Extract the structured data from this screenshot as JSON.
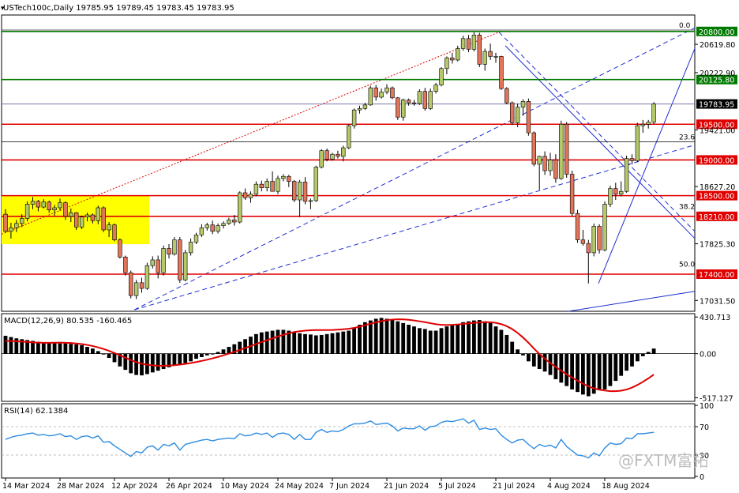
{
  "header": {
    "symbol_info": "USTech100c,Daily  19785.95 19789.45 19783.45 19783.95"
  },
  "colors": {
    "bull": "#b5c96a",
    "bear": "#e2765a",
    "candle_outline": "#000000",
    "support_line": "#e00000",
    "resistance_line": "#007a00",
    "trend_line": "#1f2fd1",
    "macd_signal": "#e00000",
    "rsi_line": "#2d8ce0",
    "highlight": "#ffff00",
    "current_price_line": "#7777aa"
  },
  "chart_data": [
    {
      "type": "candlestick",
      "title": "USTech100c,Daily",
      "ohlc_header": [
        19785.95,
        19789.45,
        19783.45,
        19783.95
      ],
      "ylim": [
        16880,
        21030
      ],
      "y_tick_labels": [
        "20619.80",
        "20222.90",
        "19421.00",
        "18627.20",
        "17825.30",
        "17031.50"
      ],
      "y_ticks": [
        20619.8,
        20222.9,
        19421.0,
        18627.2,
        17825.3,
        17031.5
      ],
      "x_tick_labels": [
        "14 Mar 2024",
        "28 Mar 2024",
        "12 Apr 2024",
        "26 Apr 2024",
        "10 May 2024",
        "24 May 2024",
        "7 Jun 2024",
        "21 Jun 2024",
        "5 Jul 2024",
        "21 Jul 2024",
        "4 Aug 2024",
        "18 Aug 2024"
      ],
      "x_tick_index": [
        0,
        10,
        20,
        30,
        40,
        50,
        60,
        70,
        80,
        90,
        100,
        110
      ],
      "horizontal_levels": [
        {
          "label": "20800.00",
          "value": 20800,
          "color": "green"
        },
        {
          "label": "20125.80",
          "value": 20125.8,
          "color": "green"
        },
        {
          "label": "19500.00",
          "value": 19500,
          "color": "red"
        },
        {
          "label": "19000.00",
          "value": 19000,
          "color": "red"
        },
        {
          "label": "18500.00",
          "value": 18500,
          "color": "red"
        },
        {
          "label": "18210.00",
          "value": 18210,
          "color": "red"
        },
        {
          "label": "17400.00",
          "value": 17400,
          "color": "red"
        }
      ],
      "current_price": {
        "label": "19783.95",
        "value": 19783.95
      },
      "fib_labels": [
        {
          "label": "0.0",
          "value": 20820
        },
        {
          "label": "23.6",
          "value": 19255
        },
        {
          "label": "38.2",
          "value": 18280
        },
        {
          "label": "50.0",
          "value": 17470
        }
      ],
      "candles": [
        [
          18240,
          18310,
          17980,
          18000
        ],
        [
          18000,
          18120,
          17900,
          18050
        ],
        [
          18050,
          18160,
          17990,
          18110
        ],
        [
          18110,
          18240,
          18060,
          18180
        ],
        [
          18180,
          18420,
          18140,
          18380
        ],
        [
          18380,
          18480,
          18310,
          18420
        ],
        [
          18420,
          18440,
          18280,
          18340
        ],
        [
          18340,
          18450,
          18320,
          18410
        ],
        [
          18410,
          18430,
          18260,
          18300
        ],
        [
          18300,
          18370,
          18220,
          18330
        ],
        [
          18330,
          18460,
          18290,
          18400
        ],
        [
          18400,
          18420,
          18160,
          18210
        ],
        [
          18210,
          18320,
          18130,
          18260
        ],
        [
          18260,
          18270,
          18020,
          18060
        ],
        [
          18060,
          18220,
          18030,
          18200
        ],
        [
          18200,
          18260,
          18140,
          18230
        ],
        [
          18230,
          18250,
          18110,
          18150
        ],
        [
          18150,
          18360,
          18100,
          18330
        ],
        [
          18330,
          18350,
          17990,
          18020
        ],
        [
          18020,
          18130,
          17920,
          18090
        ],
        [
          18090,
          18110,
          17860,
          17880
        ],
        [
          17880,
          17900,
          17620,
          17640
        ],
        [
          17640,
          17660,
          17380,
          17420
        ],
        [
          17420,
          17450,
          17060,
          17100
        ],
        [
          17100,
          17320,
          17050,
          17280
        ],
        [
          17280,
          17350,
          17140,
          17200
        ],
        [
          17200,
          17560,
          17180,
          17520
        ],
        [
          17520,
          17650,
          17480,
          17600
        ],
        [
          17600,
          17660,
          17340,
          17420
        ],
        [
          17420,
          17800,
          17380,
          17760
        ],
        [
          17760,
          17820,
          17620,
          17680
        ],
        [
          17680,
          17920,
          17660,
          17880
        ],
        [
          17880,
          17920,
          17280,
          17320
        ],
        [
          17320,
          17740,
          17300,
          17700
        ],
        [
          17700,
          17900,
          17660,
          17850
        ],
        [
          17850,
          17980,
          17820,
          17950
        ],
        [
          17950,
          18100,
          17920,
          18050
        ],
        [
          18050,
          18120,
          18010,
          18090
        ],
        [
          18090,
          18150,
          17960,
          18000
        ],
        [
          18000,
          18110,
          17970,
          18080
        ],
        [
          18080,
          18140,
          18040,
          18110
        ],
        [
          18110,
          18190,
          18090,
          18160
        ],
        [
          18160,
          18230,
          18080,
          18130
        ],
        [
          18130,
          18560,
          18110,
          18540
        ],
        [
          18540,
          18600,
          18440,
          18470
        ],
        [
          18470,
          18560,
          18400,
          18520
        ],
        [
          18520,
          18700,
          18490,
          18660
        ],
        [
          18660,
          18710,
          18560,
          18610
        ],
        [
          18610,
          18740,
          18560,
          18700
        ],
        [
          18700,
          18840,
          18640,
          18560
        ],
        [
          18560,
          18780,
          18520,
          18740
        ],
        [
          18740,
          18800,
          18700,
          18770
        ],
        [
          18770,
          18790,
          18620,
          18700
        ],
        [
          18700,
          18720,
          18410,
          18440
        ],
        [
          18440,
          18720,
          18200,
          18690
        ],
        [
          18690,
          18760,
          18380,
          18420
        ],
        [
          18420,
          18460,
          18310,
          18430
        ],
        [
          18430,
          18920,
          18410,
          18900
        ],
        [
          18900,
          19150,
          18880,
          19130
        ],
        [
          19130,
          19160,
          18980,
          19010
        ],
        [
          19010,
          19100,
          18990,
          19080
        ],
        [
          19080,
          19130,
          19020,
          19050
        ],
        [
          19050,
          19200,
          18980,
          19170
        ],
        [
          19170,
          19500,
          19150,
          19480
        ],
        [
          19480,
          19720,
          19440,
          19700
        ],
        [
          19700,
          19760,
          19650,
          19720
        ],
        [
          19720,
          19800,
          19700,
          19770
        ],
        [
          19770,
          20040,
          19760,
          20010
        ],
        [
          20010,
          20050,
          19830,
          19880
        ],
        [
          19880,
          20000,
          19860,
          19950
        ],
        [
          19950,
          20060,
          19920,
          20010
        ],
        [
          20010,
          20030,
          19850,
          19870
        ],
        [
          19870,
          19880,
          19560,
          19600
        ],
        [
          19600,
          19860,
          19550,
          19840
        ],
        [
          19840,
          19860,
          19760,
          19800
        ],
        [
          19800,
          19840,
          19760,
          19790
        ],
        [
          19790,
          19990,
          19770,
          19960
        ],
        [
          19960,
          20010,
          19690,
          19720
        ],
        [
          19720,
          20000,
          19700,
          19960
        ],
        [
          19960,
          20080,
          19930,
          20050
        ],
        [
          20050,
          20300,
          20030,
          20280
        ],
        [
          20280,
          20450,
          20200,
          20430
        ],
        [
          20430,
          20500,
          20350,
          20400
        ],
        [
          20400,
          20600,
          20380,
          20560
        ],
        [
          20560,
          20740,
          20530,
          20700
        ],
        [
          20700,
          20750,
          20510,
          20550
        ],
        [
          20550,
          20790,
          20520,
          20750
        ],
        [
          20750,
          20780,
          20300,
          20340
        ],
        [
          20340,
          20560,
          20250,
          20520
        ],
        [
          20520,
          20630,
          20400,
          20450
        ],
        [
          20450,
          20500,
          20360,
          20450
        ],
        [
          20450,
          20460,
          19980,
          20000
        ],
        [
          20000,
          20020,
          19780,
          19800
        ],
        [
          19800,
          19820,
          19490,
          19520
        ],
        [
          19520,
          19790,
          19460,
          19740
        ],
        [
          19740,
          19850,
          19620,
          19820
        ],
        [
          19820,
          19860,
          19340,
          19380
        ],
        [
          19380,
          19400,
          18910,
          18940
        ],
        [
          18940,
          19060,
          18580,
          19050
        ],
        [
          19050,
          19120,
          18790,
          18850
        ],
        [
          18850,
          19100,
          18780,
          19000
        ],
        [
          19000,
          19080,
          18680,
          18740
        ],
        [
          18740,
          19550,
          18720,
          19500
        ],
        [
          19500,
          19530,
          18750,
          18800
        ],
        [
          18800,
          18850,
          18210,
          18250
        ],
        [
          18250,
          18300,
          17840,
          17880
        ],
        [
          17880,
          18020,
          17800,
          17830
        ],
        [
          17830,
          17880,
          17270,
          17700
        ],
        [
          17700,
          18110,
          17650,
          18070
        ],
        [
          18070,
          18100,
          17690,
          17740
        ],
        [
          17740,
          18420,
          17720,
          18380
        ],
        [
          18380,
          18640,
          18340,
          18600
        ],
        [
          18600,
          18680,
          18440,
          18520
        ],
        [
          18520,
          18700,
          18490,
          18560
        ],
        [
          18560,
          19060,
          18540,
          19020
        ],
        [
          19020,
          19080,
          18940,
          18990
        ],
        [
          18990,
          19520,
          18970,
          19480
        ],
        [
          19480,
          19560,
          19380,
          19500
        ],
        [
          19500,
          19560,
          19440,
          19530
        ],
        [
          19530,
          19810,
          19500,
          19784
        ]
      ]
    },
    {
      "type": "histogram",
      "title": "MACD(12,26,9) 80.535 -160.465",
      "ylim": [
        -560,
        470
      ],
      "y_tick_labels": [
        "430.713",
        "0.00",
        "-517.127"
      ],
      "y_ticks": [
        430.713,
        0,
        -517.127
      ],
      "histogram": [
        210,
        195,
        180,
        170,
        160,
        150,
        140,
        135,
        130,
        125,
        120,
        120,
        115,
        110,
        100,
        80,
        60,
        30,
        -10,
        -50,
        -100,
        -150,
        -190,
        -230,
        -250,
        -255,
        -240,
        -220,
        -200,
        -180,
        -160,
        -140,
        -130,
        -110,
        -90,
        -60,
        -40,
        -20,
        0,
        20,
        50,
        80,
        110,
        140,
        170,
        200,
        230,
        250,
        260,
        270,
        280,
        280,
        270,
        250,
        240,
        230,
        225,
        215,
        220,
        230,
        240,
        250,
        260,
        270,
        300,
        340,
        370,
        390,
        410,
        420,
        410,
        400,
        380,
        360,
        340,
        320,
        300,
        290,
        270,
        270,
        300,
        320,
        330,
        350,
        370,
        380,
        390,
        395,
        380,
        360,
        320,
        280,
        220,
        140,
        50,
        -20,
        -90,
        -150,
        -180,
        -210,
        -250,
        -300,
        -340,
        -380,
        -420,
        -450,
        -480,
        -500,
        -470,
        -430,
        -420,
        -380,
        -320,
        -260,
        -200,
        -150,
        -90,
        -30,
        20,
        60
      ],
      "signal": [
        150,
        148,
        145,
        142,
        138,
        133,
        130,
        128,
        128,
        129,
        130,
        128,
        125,
        120,
        113,
        103,
        90,
        74,
        55,
        33,
        8,
        -20,
        -48,
        -76,
        -100,
        -118,
        -130,
        -138,
        -142,
        -143,
        -140,
        -135,
        -128,
        -120,
        -110,
        -98,
        -85,
        -71,
        -55,
        -38,
        -19,
        1,
        22,
        44,
        67,
        90,
        113,
        136,
        158,
        180,
        202,
        222,
        240,
        254,
        264,
        270,
        275,
        277,
        278,
        278,
        279,
        282,
        287,
        293,
        303,
        317,
        335,
        352,
        368,
        382,
        394,
        401,
        404,
        403,
        398,
        390,
        380,
        370,
        358,
        346,
        339,
        337,
        339,
        343,
        349,
        356,
        362,
        367,
        370,
        369,
        362,
        347,
        323,
        289,
        244,
        190,
        128,
        60,
        -3,
        -60,
        -110,
        -156,
        -200,
        -242,
        -281,
        -318,
        -352,
        -384,
        -407,
        -423,
        -433,
        -440,
        -441,
        -435,
        -421,
        -398,
        -367,
        -331,
        -290,
        -245
      ]
    },
    {
      "type": "line",
      "title": "RSI(14) 62.1384",
      "ylim": [
        0,
        100
      ],
      "y_tick_labels": [
        "100",
        "70",
        "30",
        "0"
      ],
      "y_ticks": [
        100,
        70,
        30,
        0
      ],
      "values": [
        52,
        55,
        57,
        58,
        60,
        61,
        58,
        59,
        57,
        58,
        60,
        56,
        57,
        52,
        56,
        57,
        54,
        57,
        48,
        49,
        43,
        38,
        33,
        28,
        35,
        33,
        41,
        43,
        37,
        45,
        43,
        47,
        37,
        45,
        47,
        49,
        51,
        52,
        50,
        52,
        53,
        54,
        53,
        60,
        57,
        58,
        61,
        59,
        61,
        55,
        60,
        61,
        59,
        52,
        59,
        52,
        52,
        62,
        66,
        62,
        64,
        63,
        66,
        71,
        74,
        74,
        75,
        78,
        73,
        74,
        75,
        71,
        64,
        68,
        67,
        67,
        71,
        65,
        70,
        71,
        76,
        78,
        77,
        79,
        81,
        75,
        79,
        66,
        68,
        66,
        67,
        58,
        52,
        47,
        51,
        52,
        45,
        39,
        45,
        42,
        44,
        40,
        52,
        42,
        36,
        30,
        29,
        26,
        33,
        29,
        40,
        47,
        45,
        46,
        54,
        53,
        60,
        60,
        61,
        62
      ]
    }
  ],
  "watermark": "@FXTM富拓"
}
